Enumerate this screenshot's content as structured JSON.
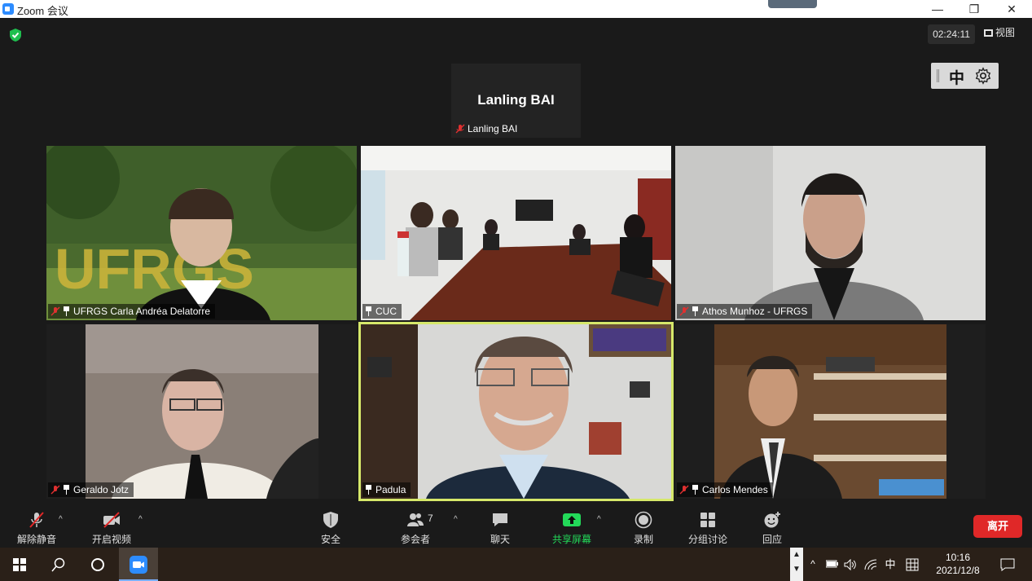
{
  "window": {
    "title": "Zoom 会议",
    "minimize_glyph": "—",
    "restore_glyph": "❐",
    "close_glyph": "✕"
  },
  "meeting_header": {
    "elapsed_time": "02:24:11",
    "view_label": "视图",
    "language_label": "中",
    "security_status_icon": "green-shield-icon"
  },
  "participants": {
    "active_speaker": {
      "display_text": "Lanling BAI",
      "name_tag": "Lanling BAI",
      "muted": true
    },
    "tiles": [
      {
        "name": "UFRGS  Carla Andréa Delatorre",
        "muted": true,
        "pinned": true
      },
      {
        "name": "CUC",
        "muted": false,
        "pinned": true
      },
      {
        "name": "Athos Munhoz - UFRGS",
        "muted": true,
        "pinned": true
      },
      {
        "name": "Geraldo Jotz",
        "muted": true,
        "pinned": true
      },
      {
        "name": "Padula",
        "muted": false,
        "pinned": true,
        "speaking": true
      },
      {
        "name": "Carlos Mendes",
        "muted": true,
        "pinned": true
      }
    ]
  },
  "toolbar": {
    "unmute_label": "解除静音",
    "start_video_label": "开启视频",
    "security_label": "安全",
    "participants_label": "参会者",
    "participants_count": "7",
    "chat_label": "聊天",
    "share_screen_label": "共享屏幕",
    "record_label": "录制",
    "breakout_label": "分组讨论",
    "reactions_label": "回应",
    "leave_label": "离开"
  },
  "taskbar": {
    "ime_label": "中",
    "time": "10:16",
    "date": "2021/12/8"
  },
  "colors": {
    "share_green": "#23d959",
    "leave_red": "#e02828",
    "active_speaker_border": "#d6e86a"
  }
}
